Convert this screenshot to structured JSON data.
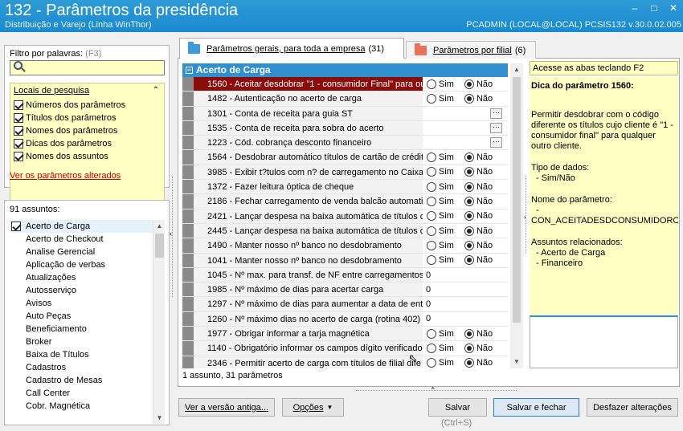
{
  "window": {
    "title": "132 - Parâmetros da presidência",
    "subtitle": "Distribuição e Varejo (Linha WinThor)",
    "info": "PCADMIN (LOCAL@LOCAL)   PCSIS132  v.30.0.02.005",
    "controls": {
      "minimize": "–",
      "restore": "□",
      "close": "✕"
    }
  },
  "filter": {
    "label": "Filtro por palavras:",
    "hotkey": "(F3)",
    "value": "",
    "placeholder": ""
  },
  "search_locations": {
    "title": "Locais de pesquisa",
    "items": [
      {
        "label": "Números dos parâmetros",
        "checked": true
      },
      {
        "label": "Títulos dos parâmetros",
        "checked": true
      },
      {
        "label": "Nomes dos parâmetros",
        "checked": true
      },
      {
        "label": "Dicas dos parâmetros",
        "checked": true
      },
      {
        "label": "Nomes dos assuntos",
        "checked": true
      }
    ],
    "altered_link": "Ver os parâmetros alterados"
  },
  "subjects": {
    "count_label": "91 assuntos:",
    "items": [
      "Acerto de Carga",
      "Acerto de Checkout",
      "Analise Gerencial",
      "Aplicação de verbas",
      "Atualizações",
      "Autosserviço",
      "Avisos",
      "Auto Peças",
      "Beneficiamento",
      "Broker",
      "Baixa de Títulos",
      "Cadastros",
      "Cadastro de Mesas",
      "Call Center",
      "Cobr. Magnética"
    ]
  },
  "tabs": [
    {
      "label": "Parâmetros gerais, para toda a empresa",
      "count": "(31)",
      "active": true
    },
    {
      "label": "Parâmetros por filial",
      "count": "(6)",
      "active": false
    }
  ],
  "grid": {
    "group": "Acerto de Carga",
    "yes_label": "Sim",
    "no_label": "Não",
    "rows": [
      {
        "name": "1560 - Aceitar desdobrar \"1 - consumidor Final\" para ou",
        "kind": "radio",
        "value": "Não",
        "selected": true
      },
      {
        "name": "1482 - Autenticação no acerto de carga",
        "kind": "radio",
        "value": "Não"
      },
      {
        "name": "1301 - Conta de receita para guia ST",
        "kind": "lookup",
        "value": ""
      },
      {
        "name": "1535 - Conta de receita para sobra do acerto",
        "kind": "lookup",
        "value": ""
      },
      {
        "name": "1223 - Cód. cobrança desconto financeiro",
        "kind": "lookup",
        "value": ""
      },
      {
        "name": "1564 - Desdobrar automático títulos de cartão de crédit",
        "kind": "radio",
        "value": "Não"
      },
      {
        "name": "3985 - Exibir t?tulos com n? de carregamento no Caixa",
        "kind": "radio",
        "value": "Não"
      },
      {
        "name": "1372 - Fazer leitura óptica de cheque",
        "kind": "radio",
        "value": "Não"
      },
      {
        "name": "2186 - Fechar carregamento de venda balcão automatic",
        "kind": "radio",
        "value": "Não"
      },
      {
        "name": "2421 - Lançar despesa na baixa automática de títulos co",
        "kind": "radio",
        "value": "Não"
      },
      {
        "name": "2445 - Lançar despesa na baixa automática de títulos co",
        "kind": "radio",
        "value": "Não"
      },
      {
        "name": "1490 - Manter nosso nº banco no desdobramento",
        "kind": "radio",
        "value": "Não"
      },
      {
        "name": "1041 - Manter nosso nº banco no desdobramento",
        "kind": "radio",
        "value": "Não"
      },
      {
        "name": "1045 - Nº max. para transf. de NF entre carregamentos",
        "kind": "number",
        "value": "0"
      },
      {
        "name": "1985 - Nº máximo de dias para acertar carga",
        "kind": "number",
        "value": "0"
      },
      {
        "name": "1297 - Nº máximo de dias para aumentar a data de entr",
        "kind": "number",
        "value": "0"
      },
      {
        "name": "1260 - Nº máximo dias no acerto de carga (rotina 402)",
        "kind": "number",
        "value": "0"
      },
      {
        "name": "1977 - Obrigar informar a tarja magnética",
        "kind": "radio",
        "value": "Não"
      },
      {
        "name": "1140 - Obrigatório informar os campos dígito verificador",
        "kind": "radio",
        "value": "Não"
      },
      {
        "name": "2346 - Permitir acerto de carga com títulos de filial dife",
        "kind": "radio",
        "value": "Não"
      }
    ],
    "status": "1 assunto, 31 parâmetros"
  },
  "help": {
    "hint": "Acesse as abas teclando F2",
    "title": "Dica do parâmetro 1560:",
    "description": "Permitir desdobrar com o código diferente os títulos cujo cliente é \"1 - consumidor final\" para qualquer outro cliente.",
    "data_type_label": "Tipo de dados:",
    "data_type_value": "- Sim/Não",
    "param_name_label": "Nome do parâmetro:",
    "param_name_dash": "-",
    "param_name_value": "CON_ACEITADESDCONSUMIDOROUT",
    "related_label": "Assuntos relacionados:",
    "related": [
      "- Acerto de Carga",
      "- Financeiro"
    ]
  },
  "buttons": {
    "old_version": "Ver a versão antiga...",
    "options": "Opções",
    "save": "Salvar",
    "save_shortcut": "(Ctrl+S)",
    "save_close": "Salvar e fechar",
    "undo": "Desfazer alterações"
  },
  "colors": {
    "titlebar": "#1a8ad0",
    "group_header": "#2f8fcf",
    "selected_row": "#8b0a0a",
    "highlight_yellow": "#ffffc4"
  }
}
